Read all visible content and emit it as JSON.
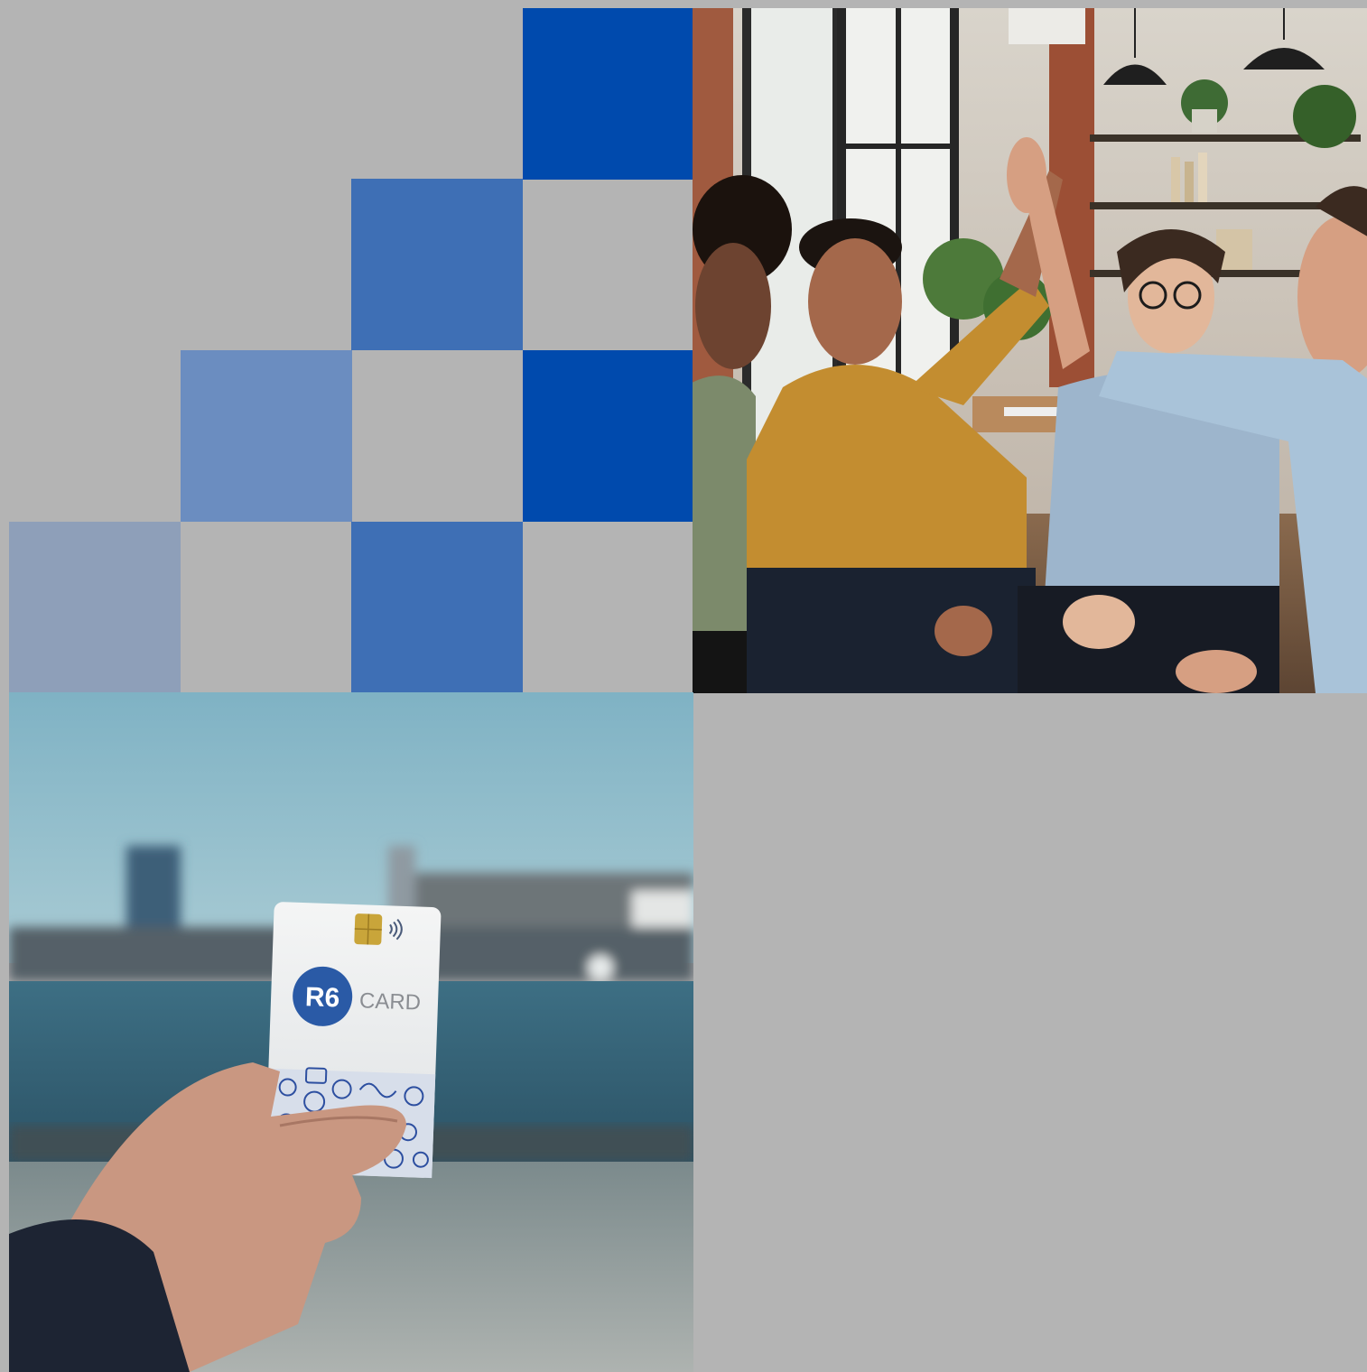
{
  "colors": {
    "background": "#b4b4b4",
    "tile_deep": "#004aad",
    "tile_mid": "#3e6fb5",
    "tile_soft": "#6b8dc0",
    "tile_muted": "#8e9fb9"
  },
  "mosaic": {
    "tiles": [
      {
        "shade": "tile_deep"
      },
      {
        "shade": "tile_mid"
      },
      {
        "shade": "tile_soft"
      },
      {
        "shade": "tile_deep"
      },
      {
        "shade": "tile_muted"
      },
      {
        "shade": "tile_mid"
      }
    ]
  },
  "team_photo": {
    "icon": "team-high-five-photo"
  },
  "card_photo": {
    "icon": "hand-holding-card-photo",
    "card": {
      "logo_text": "R6",
      "brand_text": "CARD"
    }
  }
}
